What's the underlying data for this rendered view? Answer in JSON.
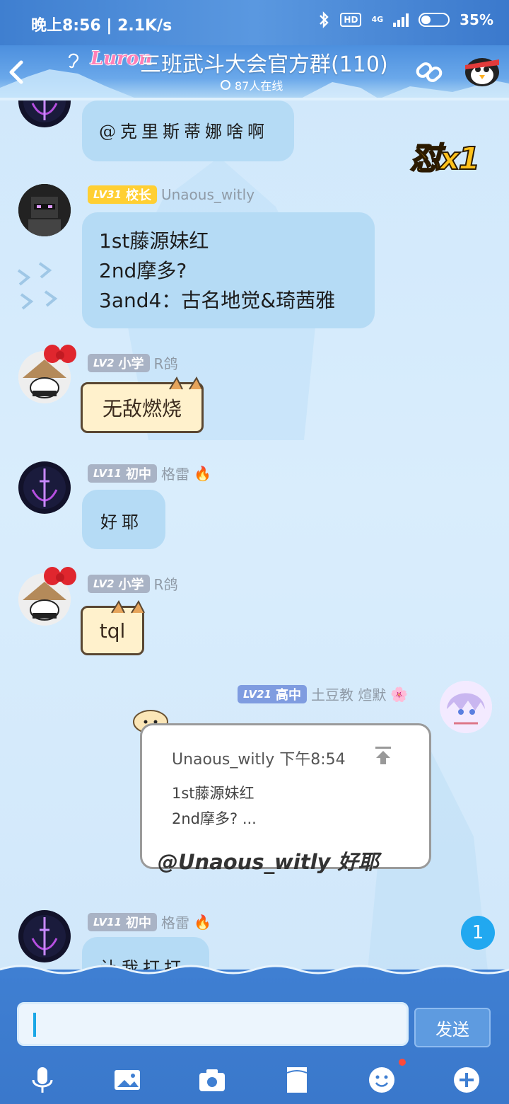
{
  "status_bar": {
    "time_speed": "晚上8:56 | 2.1K/s",
    "network": "4G",
    "hd": "HD",
    "battery_text": "35%"
  },
  "header": {
    "logo_text": "Luron",
    "group_name": "三班武斗大会官方群(110)",
    "online_text": "87人在线"
  },
  "combo_text": "怼x1",
  "messages": [
    {
      "bubble": "@克里斯蒂娜啥啊"
    },
    {
      "level": "LV31",
      "title": "校长",
      "name": "Unaous_witly",
      "lines": [
        "1st藤源妹红",
        "2nd摩多?",
        "3and4：古名地觉&琦茜雅"
      ]
    },
    {
      "level": "LV2",
      "title": "小学",
      "name": "R鸽",
      "bubble": "无敌燃烧"
    },
    {
      "level": "LV11",
      "title": "初中",
      "name": "格雷",
      "bubble": "好耶"
    },
    {
      "level": "LV2",
      "title": "小学",
      "name": "R鸽",
      "bubble": "tql"
    },
    {
      "level": "LV21",
      "title": "高中",
      "name": "土豆教 煊默",
      "quote_head": "Unaous_witly 下午8:54",
      "quote_lines": [
        "1st藤源妹红",
        "2nd摩多? ..."
      ],
      "reply": "@Unaous_witly 好耶"
    },
    {
      "level": "LV11",
      "title": "初中",
      "name": "格雷",
      "bubble": "让我打打"
    }
  ],
  "unread_count": "1",
  "input": {
    "value": "",
    "send_label": "发送"
  },
  "toolbar": [
    "mic-icon",
    "image-icon",
    "camera-icon",
    "file-icon",
    "emoji-icon",
    "plus-icon"
  ],
  "colors": {
    "accent": "#3f7fd2",
    "bubble": "#b5dbf5",
    "unread": "#21a8f0"
  }
}
